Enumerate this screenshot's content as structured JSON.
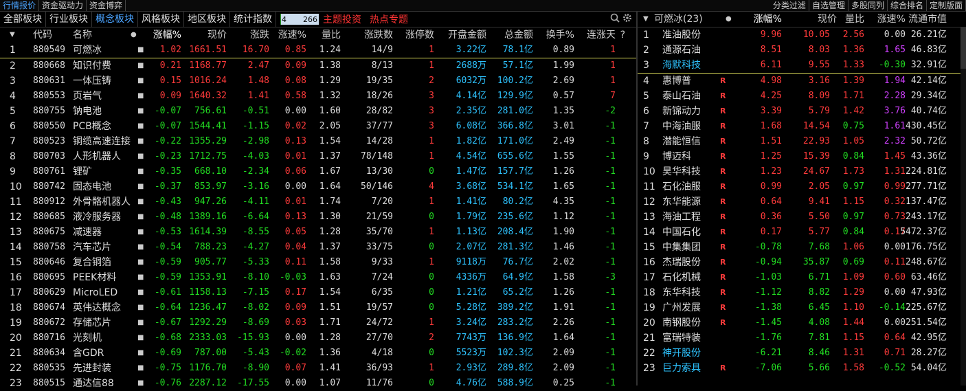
{
  "topbar": {
    "left_tabs": [
      "行情报价",
      "资金驱动力",
      "资金博弈"
    ],
    "right_tabs": [
      "分类过滤",
      "自选管理",
      "多股同列",
      "综合排名",
      "定制版面"
    ]
  },
  "secbar": {
    "tabs": [
      "全部板块",
      "行业板块",
      "概念板块",
      "风格板块",
      "地区板块",
      "统计指数"
    ],
    "active_tab": 2,
    "ratio_left": "4",
    "ratio_right": "266",
    "ratio_fraction": 0.015,
    "links": [
      "主题投资",
      "热点专题"
    ]
  },
  "left_table": {
    "headers": [
      "代码",
      "名称",
      "涨幅%",
      "现价",
      "涨跌",
      "涨速%",
      "量比",
      "涨跌数",
      "涨停数",
      "开盘金额",
      "总金额",
      "换手%",
      "连涨天",
      "?"
    ],
    "rows": [
      {
        "no": "1",
        "code": "880549",
        "name": "可燃冰",
        "pct": "1.02",
        "price": "1661.51",
        "chg": "16.70",
        "spd": "0.85",
        "vr": "1.24",
        "ud": "14/9",
        "lim": "1",
        "open": "3.22亿",
        "total": "78.1亿",
        "turn": "0.89",
        "days": "1",
        "dir": "up"
      },
      {
        "no": "2",
        "code": "880668",
        "name": "知识付费",
        "pct": "0.21",
        "price": "1168.77",
        "chg": "2.47",
        "spd": "0.09",
        "vr": "1.38",
        "ud": "8/13",
        "lim": "1",
        "open": "2688万",
        "total": "57.1亿",
        "turn": "1.99",
        "days": "1",
        "dir": "up"
      },
      {
        "no": "3",
        "code": "880631",
        "name": "一体压铸",
        "pct": "0.15",
        "price": "1016.24",
        "chg": "1.48",
        "spd": "0.08",
        "vr": "1.29",
        "ud": "19/35",
        "lim": "2",
        "open": "6032万",
        "total": "100.2亿",
        "turn": "2.69",
        "days": "1",
        "dir": "up"
      },
      {
        "no": "4",
        "code": "880553",
        "name": "页岩气",
        "pct": "0.09",
        "price": "1640.32",
        "chg": "1.41",
        "spd": "0.58",
        "vr": "1.32",
        "ud": "18/26",
        "lim": "3",
        "open": "4.14亿",
        "total": "129.9亿",
        "turn": "0.57",
        "days": "7",
        "dir": "up"
      },
      {
        "no": "5",
        "code": "880755",
        "name": "钠电池",
        "pct": "-0.07",
        "price": "756.61",
        "chg": "-0.51",
        "spd": "0.00",
        "vr": "1.60",
        "ud": "28/82",
        "lim": "3",
        "open": "2.35亿",
        "total": "281.0亿",
        "turn": "1.35",
        "days": "-2",
        "dir": "dn"
      },
      {
        "no": "6",
        "code": "880550",
        "name": "PCB概念",
        "pct": "-0.07",
        "price": "1544.41",
        "chg": "-1.15",
        "spd": "0.02",
        "vr": "2.05",
        "ud": "37/77",
        "lim": "3",
        "open": "6.08亿",
        "total": "366.8亿",
        "turn": "3.01",
        "days": "-1",
        "dir": "dn"
      },
      {
        "no": "7",
        "code": "880523",
        "name": "铜缆高速连接",
        "pct": "-0.22",
        "price": "1355.29",
        "chg": "-2.98",
        "spd": "0.13",
        "vr": "1.54",
        "ud": "14/28",
        "lim": "1",
        "open": "1.82亿",
        "total": "171.0亿",
        "turn": "2.49",
        "days": "-1",
        "dir": "dn"
      },
      {
        "no": "8",
        "code": "880703",
        "name": "人形机器人",
        "pct": "-0.23",
        "price": "1712.75",
        "chg": "-4.03",
        "spd": "0.01",
        "vr": "1.37",
        "ud": "78/148",
        "lim": "1",
        "open": "4.54亿",
        "total": "655.6亿",
        "turn": "1.55",
        "days": "-1",
        "dir": "dn"
      },
      {
        "no": "9",
        "code": "880761",
        "name": "锂矿",
        "pct": "-0.35",
        "price": "668.10",
        "chg": "-2.34",
        "spd": "0.06",
        "vr": "1.67",
        "ud": "13/30",
        "lim": "0",
        "open": "1.47亿",
        "total": "157.7亿",
        "turn": "1.26",
        "days": "-1",
        "dir": "dn"
      },
      {
        "no": "10",
        "code": "880742",
        "name": "固态电池",
        "pct": "-0.37",
        "price": "853.97",
        "chg": "-3.16",
        "spd": "0.00",
        "vr": "1.64",
        "ud": "50/146",
        "lim": "4",
        "open": "3.68亿",
        "total": "534.1亿",
        "turn": "1.65",
        "days": "-1",
        "dir": "dn"
      },
      {
        "no": "11",
        "code": "880912",
        "name": "外骨骼机器人",
        "pct": "-0.43",
        "price": "947.26",
        "chg": "-4.11",
        "spd": "0.01",
        "vr": "1.74",
        "ud": "7/20",
        "lim": "1",
        "open": "1.41亿",
        "total": "80.2亿",
        "turn": "4.35",
        "days": "-1",
        "dir": "dn"
      },
      {
        "no": "12",
        "code": "880685",
        "name": "液冷服务器",
        "pct": "-0.48",
        "price": "1389.16",
        "chg": "-6.64",
        "spd": "0.13",
        "vr": "1.30",
        "ud": "21/59",
        "lim": "0",
        "open": "1.79亿",
        "total": "235.6亿",
        "turn": "1.12",
        "days": "-1",
        "dir": "dn"
      },
      {
        "no": "13",
        "code": "880675",
        "name": "减速器",
        "pct": "-0.53",
        "price": "1614.39",
        "chg": "-8.55",
        "spd": "0.05",
        "vr": "1.28",
        "ud": "35/70",
        "lim": "1",
        "open": "1.13亿",
        "total": "208.4亿",
        "turn": "1.90",
        "days": "-1",
        "dir": "dn"
      },
      {
        "no": "14",
        "code": "880758",
        "name": "汽车芯片",
        "pct": "-0.54",
        "price": "788.23",
        "chg": "-4.27",
        "spd": "0.04",
        "vr": "1.37",
        "ud": "33/75",
        "lim": "0",
        "open": "2.07亿",
        "total": "281.3亿",
        "turn": "1.46",
        "days": "-1",
        "dir": "dn"
      },
      {
        "no": "15",
        "code": "880646",
        "name": "复合铜箔",
        "pct": "-0.59",
        "price": "905.77",
        "chg": "-5.33",
        "spd": "0.11",
        "vr": "1.58",
        "ud": "9/33",
        "lim": "1",
        "open": "9118万",
        "total": "76.7亿",
        "turn": "2.02",
        "days": "-1",
        "dir": "dn"
      },
      {
        "no": "16",
        "code": "880695",
        "name": "PEEK材料",
        "pct": "-0.59",
        "price": "1353.91",
        "chg": "-8.10",
        "spd": "-0.03",
        "vr": "1.63",
        "ud": "7/24",
        "lim": "0",
        "open": "4336万",
        "total": "64.9亿",
        "turn": "1.58",
        "days": "-3",
        "dir": "dn"
      },
      {
        "no": "17",
        "code": "880629",
        "name": "MicroLED",
        "pct": "-0.61",
        "price": "1158.13",
        "chg": "-7.15",
        "spd": "0.17",
        "vr": "1.54",
        "ud": "6/35",
        "lim": "0",
        "open": "1.21亿",
        "total": "65.2亿",
        "turn": "1.26",
        "days": "-1",
        "dir": "dn"
      },
      {
        "no": "18",
        "code": "880674",
        "name": "英伟达概念",
        "pct": "-0.64",
        "price": "1236.47",
        "chg": "-8.02",
        "spd": "0.09",
        "vr": "1.51",
        "ud": "19/57",
        "lim": "0",
        "open": "5.28亿",
        "total": "389.2亿",
        "turn": "1.91",
        "days": "-1",
        "dir": "dn"
      },
      {
        "no": "19",
        "code": "880672",
        "name": "存储芯片",
        "pct": "-0.67",
        "price": "1292.29",
        "chg": "-8.69",
        "spd": "0.03",
        "vr": "1.71",
        "ud": "24/72",
        "lim": "1",
        "open": "3.24亿",
        "total": "283.2亿",
        "turn": "2.26",
        "days": "-1",
        "dir": "dn"
      },
      {
        "no": "20",
        "code": "880716",
        "name": "光刻机",
        "pct": "-0.68",
        "price": "2333.03",
        "chg": "-15.93",
        "spd": "0.00",
        "vr": "1.28",
        "ud": "27/70",
        "lim": "2",
        "open": "7743万",
        "total": "136.9亿",
        "turn": "1.64",
        "days": "-1",
        "dir": "dn"
      },
      {
        "no": "21",
        "code": "880634",
        "name": "含GDR",
        "pct": "-0.69",
        "price": "787.00",
        "chg": "-5.43",
        "spd": "-0.02",
        "vr": "1.36",
        "ud": "4/18",
        "lim": "0",
        "open": "5523万",
        "total": "102.3亿",
        "turn": "2.09",
        "days": "-1",
        "dir": "dn"
      },
      {
        "no": "22",
        "code": "880535",
        "name": "先进封装",
        "pct": "-0.75",
        "price": "1176.70",
        "chg": "-8.90",
        "spd": "0.07",
        "vr": "1.41",
        "ud": "36/93",
        "lim": "1",
        "open": "2.93亿",
        "total": "289.8亿",
        "turn": "2.09",
        "days": "-1",
        "dir": "dn"
      },
      {
        "no": "23",
        "code": "880515",
        "name": "通达信88",
        "pct": "-0.76",
        "price": "2287.12",
        "chg": "-17.55",
        "spd": "0.00",
        "vr": "1.07",
        "ud": "11/76",
        "lim": "0",
        "open": "4.76亿",
        "total": "588.9亿",
        "turn": "0.25",
        "days": "-1",
        "dir": "dn"
      }
    ]
  },
  "right_panel": {
    "title": "可燃冰(23)",
    "headers": [
      "涨幅%",
      "现价",
      "量比",
      "涨速%",
      "流通市值"
    ],
    "rows": [
      {
        "no": "1",
        "name": "准油股份",
        "r": "",
        "pct": "9.96",
        "price": "10.05",
        "vr": "2.56",
        "spd": "0.00",
        "cap": "26.21亿",
        "dir": "up",
        "spd_c": "fl",
        "name_c": "fl"
      },
      {
        "no": "2",
        "name": "通源石油",
        "r": "",
        "pct": "8.51",
        "price": "8.03",
        "vr": "1.36",
        "spd": "1.65",
        "cap": "46.83亿",
        "dir": "up",
        "spd_c": "pu",
        "name_c": "fl"
      },
      {
        "no": "3",
        "name": "海默科技",
        "r": "",
        "pct": "6.11",
        "price": "9.55",
        "vr": "1.33",
        "spd": "-0.30",
        "cap": "32.91亿",
        "dir": "up",
        "spd_c": "dn",
        "name_c": "bl"
      },
      {
        "no": "4",
        "name": "惠博普",
        "r": "R",
        "pct": "4.98",
        "price": "3.16",
        "vr": "1.39",
        "spd": "1.94",
        "cap": "42.14亿",
        "dir": "up",
        "spd_c": "pu",
        "name_c": "fl"
      },
      {
        "no": "5",
        "name": "泰山石油",
        "r": "R",
        "pct": "4.25",
        "price": "8.09",
        "vr": "1.71",
        "spd": "2.28",
        "cap": "29.34亿",
        "dir": "up",
        "spd_c": "pu",
        "name_c": "fl"
      },
      {
        "no": "6",
        "name": "新锦动力",
        "r": "R",
        "pct": "3.39",
        "price": "5.79",
        "vr": "1.42",
        "spd": "3.76",
        "cap": "40.74亿",
        "dir": "up",
        "spd_c": "pu",
        "name_c": "fl"
      },
      {
        "no": "7",
        "name": "中海油服",
        "r": "R",
        "pct": "1.68",
        "price": "14.54",
        "vr": "0.75",
        "spd": "1.61",
        "cap": "430.45亿",
        "dir": "up",
        "spd_c": "pu",
        "name_c": "fl"
      },
      {
        "no": "8",
        "name": "潜能恒信",
        "r": "R",
        "pct": "1.51",
        "price": "22.93",
        "vr": "1.05",
        "spd": "2.32",
        "cap": "50.72亿",
        "dir": "up",
        "spd_c": "pu",
        "name_c": "fl"
      },
      {
        "no": "9",
        "name": "博迈科",
        "r": "R",
        "pct": "1.25",
        "price": "15.39",
        "vr": "0.84",
        "spd": "1.45",
        "cap": "43.36亿",
        "dir": "up",
        "spd_c": "up",
        "name_c": "fl"
      },
      {
        "no": "10",
        "name": "昊华科技",
        "r": "R",
        "pct": "1.23",
        "price": "24.67",
        "vr": "1.73",
        "spd": "1.31",
        "cap": "224.81亿",
        "dir": "up",
        "spd_c": "up",
        "name_c": "fl"
      },
      {
        "no": "11",
        "name": "石化油服",
        "r": "R",
        "pct": "0.99",
        "price": "2.05",
        "vr": "0.97",
        "spd": "0.99",
        "cap": "277.71亿",
        "dir": "up",
        "spd_c": "up",
        "name_c": "fl"
      },
      {
        "no": "12",
        "name": "东华能源",
        "r": "R",
        "pct": "0.64",
        "price": "9.41",
        "vr": "1.15",
        "spd": "0.32",
        "cap": "137.47亿",
        "dir": "up",
        "spd_c": "up",
        "name_c": "fl"
      },
      {
        "no": "13",
        "name": "海油工程",
        "r": "R",
        "pct": "0.36",
        "price": "5.50",
        "vr": "0.97",
        "spd": "0.73",
        "cap": "243.17亿",
        "dir": "up",
        "spd_c": "up",
        "name_c": "fl"
      },
      {
        "no": "14",
        "name": "中国石化",
        "r": "R",
        "pct": "0.17",
        "price": "5.77",
        "vr": "0.84",
        "spd": "0.17",
        "cap": "5472.37亿",
        "dir": "up",
        "spd_c": "up",
        "name_c": "fl"
      },
      {
        "no": "15",
        "name": "中集集团",
        "r": "R",
        "pct": "-0.78",
        "price": "7.68",
        "vr": "1.06",
        "spd": "0.00",
        "cap": "176.75亿",
        "dir": "dn",
        "spd_c": "fl",
        "name_c": "fl"
      },
      {
        "no": "16",
        "name": "杰瑞股份",
        "r": "R",
        "pct": "-0.94",
        "price": "35.87",
        "vr": "0.69",
        "spd": "0.11",
        "cap": "248.67亿",
        "dir": "dn",
        "spd_c": "up",
        "name_c": "fl"
      },
      {
        "no": "17",
        "name": "石化机械",
        "r": "R",
        "pct": "-1.03",
        "price": "6.71",
        "vr": "1.09",
        "spd": "0.60",
        "cap": "63.46亿",
        "dir": "dn",
        "spd_c": "up",
        "name_c": "fl"
      },
      {
        "no": "18",
        "name": "东华科技",
        "r": "R",
        "pct": "-1.12",
        "price": "8.82",
        "vr": "1.29",
        "spd": "0.00",
        "cap": "47.93亿",
        "dir": "dn",
        "spd_c": "fl",
        "name_c": "fl"
      },
      {
        "no": "19",
        "name": "广州发展",
        "r": "R",
        "pct": "-1.38",
        "price": "6.45",
        "vr": "1.10",
        "spd": "-0.14",
        "cap": "225.67亿",
        "dir": "dn",
        "spd_c": "dn",
        "name_c": "fl"
      },
      {
        "no": "20",
        "name": "南钢股份",
        "r": "R",
        "pct": "-1.45",
        "price": "4.08",
        "vr": "1.44",
        "spd": "0.00",
        "cap": "251.54亿",
        "dir": "dn",
        "spd_c": "fl",
        "name_c": "fl"
      },
      {
        "no": "21",
        "name": "富瑞特装",
        "r": "",
        "pct": "-1.76",
        "price": "7.81",
        "vr": "1.15",
        "spd": "0.64",
        "cap": "42.95亿",
        "dir": "dn",
        "spd_c": "up",
        "name_c": "fl"
      },
      {
        "no": "22",
        "name": "神开股份",
        "r": "",
        "pct": "-6.21",
        "price": "8.46",
        "vr": "1.31",
        "spd": "0.71",
        "cap": "28.27亿",
        "dir": "dn",
        "spd_c": "up",
        "name_c": "bl"
      },
      {
        "no": "23",
        "name": "巨力索具",
        "r": "R",
        "pct": "-7.06",
        "price": "5.66",
        "vr": "1.58",
        "spd": "-0.52",
        "cap": "54.04亿",
        "dir": "dn",
        "spd_c": "dn",
        "name_c": "bl"
      }
    ]
  },
  "colors": {
    "up": "#ff3b3b",
    "down": "#22dd22",
    "cyan": "#2ec3ff",
    "purple": "#d040ff",
    "background": "#000000"
  },
  "icons": [
    "search-icon",
    "gear-icon",
    "sort-down-icon"
  ]
}
